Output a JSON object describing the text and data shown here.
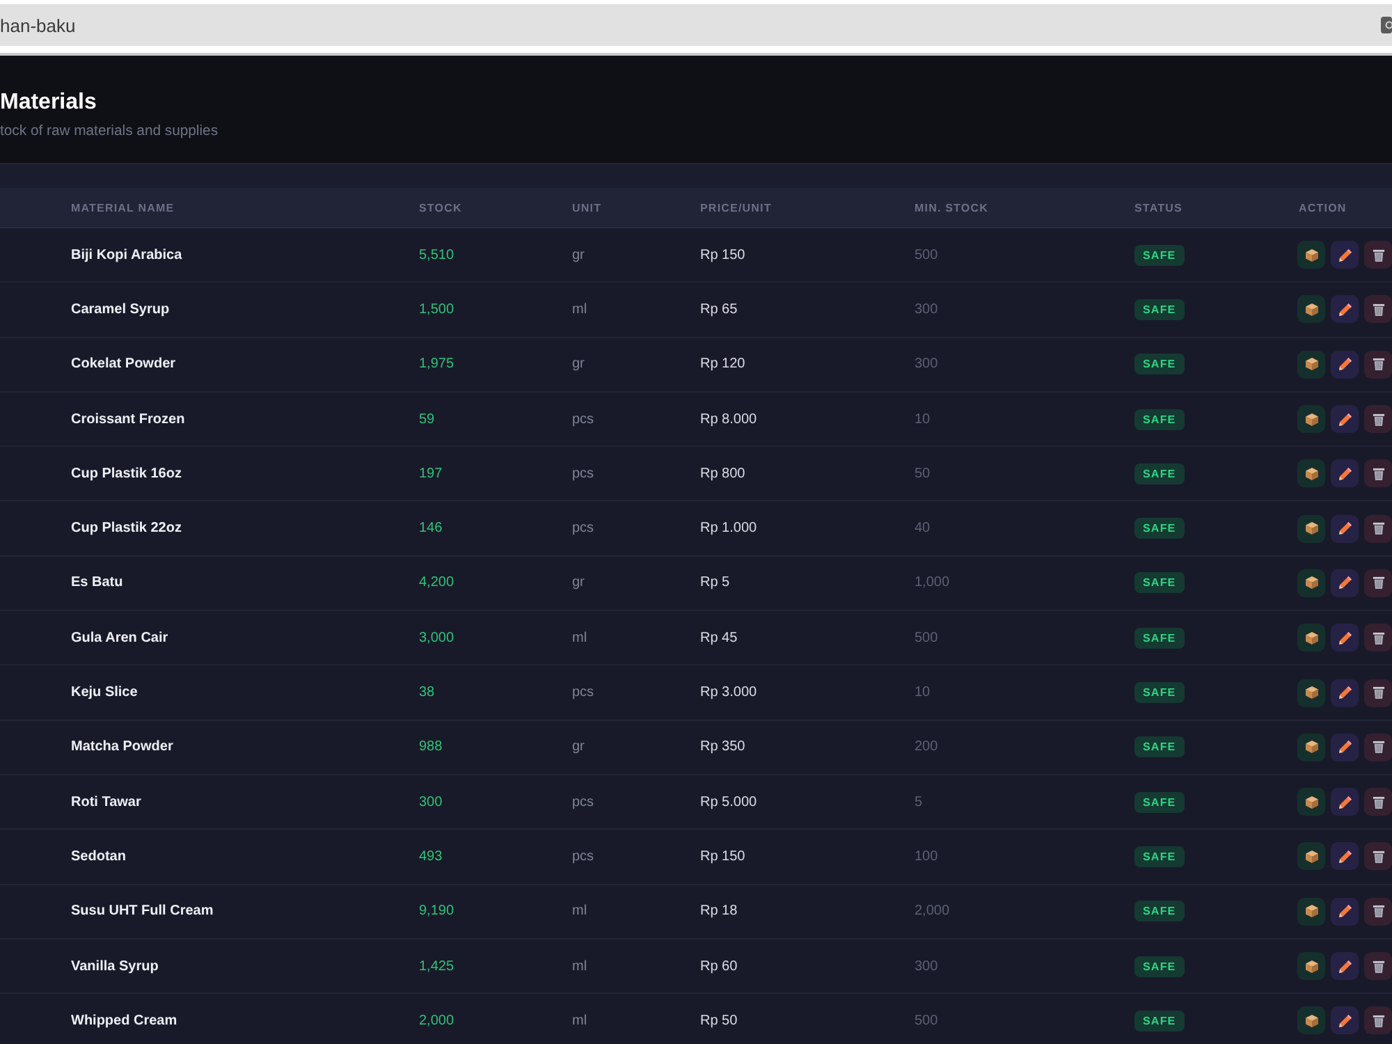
{
  "browser": {
    "address": "han-baku"
  },
  "header": {
    "title": "Materials",
    "subtitle": "tock of raw materials and supplies"
  },
  "table": {
    "columns": [
      "MATERIAL NAME",
      "STOCK",
      "UNIT",
      "PRICE/UNIT",
      "MIN. STOCK",
      "STATUS",
      "ACTION"
    ],
    "rows": [
      {
        "name": "Biji Kopi Arabica",
        "stock": "5,510",
        "unit": "gr",
        "price": "Rp 150",
        "min_stock": "500",
        "status": {
          "label": "SAFE",
          "kind": "safe"
        }
      },
      {
        "name": "Caramel Syrup",
        "stock": "1,500",
        "unit": "ml",
        "price": "Rp 65",
        "min_stock": "300",
        "status": {
          "label": "SAFE",
          "kind": "safe"
        }
      },
      {
        "name": "Cokelat Powder",
        "stock": "1,975",
        "unit": "gr",
        "price": "Rp 120",
        "min_stock": "300",
        "status": {
          "label": "SAFE",
          "kind": "safe"
        }
      },
      {
        "name": "Croissant Frozen",
        "stock": "59",
        "unit": "pcs",
        "price": "Rp 8.000",
        "min_stock": "10",
        "status": {
          "label": "SAFE",
          "kind": "safe"
        }
      },
      {
        "name": "Cup Plastik 16oz",
        "stock": "197",
        "unit": "pcs",
        "price": "Rp 800",
        "min_stock": "50",
        "status": {
          "label": "SAFE",
          "kind": "safe"
        }
      },
      {
        "name": "Cup Plastik 22oz",
        "stock": "146",
        "unit": "pcs",
        "price": "Rp 1.000",
        "min_stock": "40",
        "status": {
          "label": "SAFE",
          "kind": "safe"
        }
      },
      {
        "name": "Es Batu",
        "stock": "4,200",
        "unit": "gr",
        "price": "Rp 5",
        "min_stock": "1,000",
        "status": {
          "label": "SAFE",
          "kind": "safe"
        }
      },
      {
        "name": "Gula Aren Cair",
        "stock": "3,000",
        "unit": "ml",
        "price": "Rp 45",
        "min_stock": "500",
        "status": {
          "label": "SAFE",
          "kind": "safe"
        }
      },
      {
        "name": "Keju Slice",
        "stock": "38",
        "unit": "pcs",
        "price": "Rp 3.000",
        "min_stock": "10",
        "status": {
          "label": "SAFE",
          "kind": "safe"
        }
      },
      {
        "name": "Matcha Powder",
        "stock": "988",
        "unit": "gr",
        "price": "Rp 350",
        "min_stock": "200",
        "status": {
          "label": "SAFE",
          "kind": "safe"
        }
      },
      {
        "name": "Roti Tawar",
        "stock": "300",
        "unit": "pcs",
        "price": "Rp 5.000",
        "min_stock": "5",
        "status": {
          "label": "SAFE",
          "kind": "safe"
        }
      },
      {
        "name": "Sedotan",
        "stock": "493",
        "unit": "pcs",
        "price": "Rp 150",
        "min_stock": "100",
        "status": {
          "label": "SAFE",
          "kind": "safe"
        }
      },
      {
        "name": "Susu UHT Full Cream",
        "stock": "9,190",
        "unit": "ml",
        "price": "Rp 18",
        "min_stock": "2,000",
        "status": {
          "label": "SAFE",
          "kind": "safe"
        }
      },
      {
        "name": "Vanilla Syrup",
        "stock": "1,425",
        "unit": "ml",
        "price": "Rp 60",
        "min_stock": "300",
        "status": {
          "label": "SAFE",
          "kind": "safe"
        }
      },
      {
        "name": "Whipped Cream",
        "stock": "2,000",
        "unit": "ml",
        "price": "Rp 50",
        "min_stock": "500",
        "status": {
          "label": "SAFE",
          "kind": "safe"
        }
      }
    ]
  }
}
